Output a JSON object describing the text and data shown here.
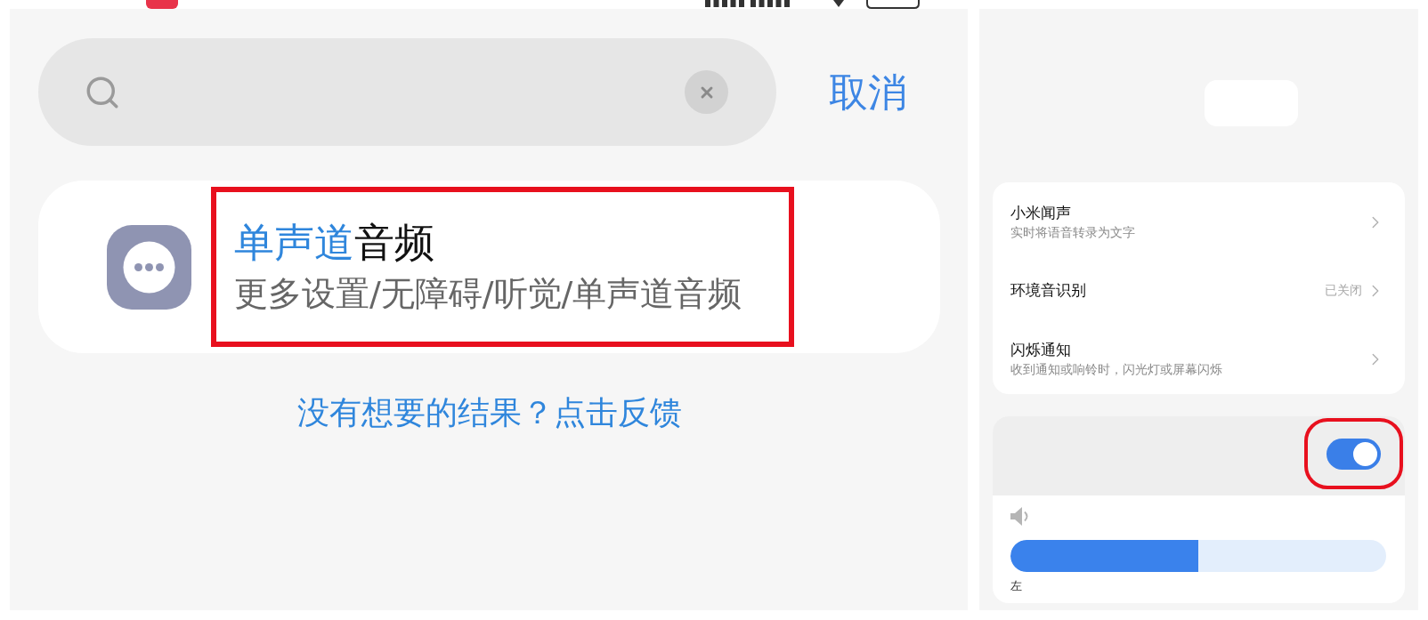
{
  "search_bar": {
    "cancel": "取消"
  },
  "results": [
    {
      "title": [
        {
          "text": "单声道",
          "match": true
        },
        {
          "text": "音频",
          "match": false
        }
      ],
      "path": "更多设置/无障碍/听觉/单声道音频",
      "highlighted": true
    }
  ],
  "feedback_link": "没有想要的结果？点击反馈",
  "settings": [
    {
      "title": "小米闻声",
      "subtitle": "实时将语音转录为文字"
    },
    {
      "title": "环境音识别",
      "value": "已关闭"
    },
    {
      "title": "闪烁通知",
      "subtitle": "收到通知或响铃时，闪光灯或屏幕闪烁"
    }
  ],
  "mono_audio": {
    "toggle": {
      "on": true,
      "highlighted": true
    },
    "balance": {
      "level": 0.5,
      "label": "左"
    }
  }
}
